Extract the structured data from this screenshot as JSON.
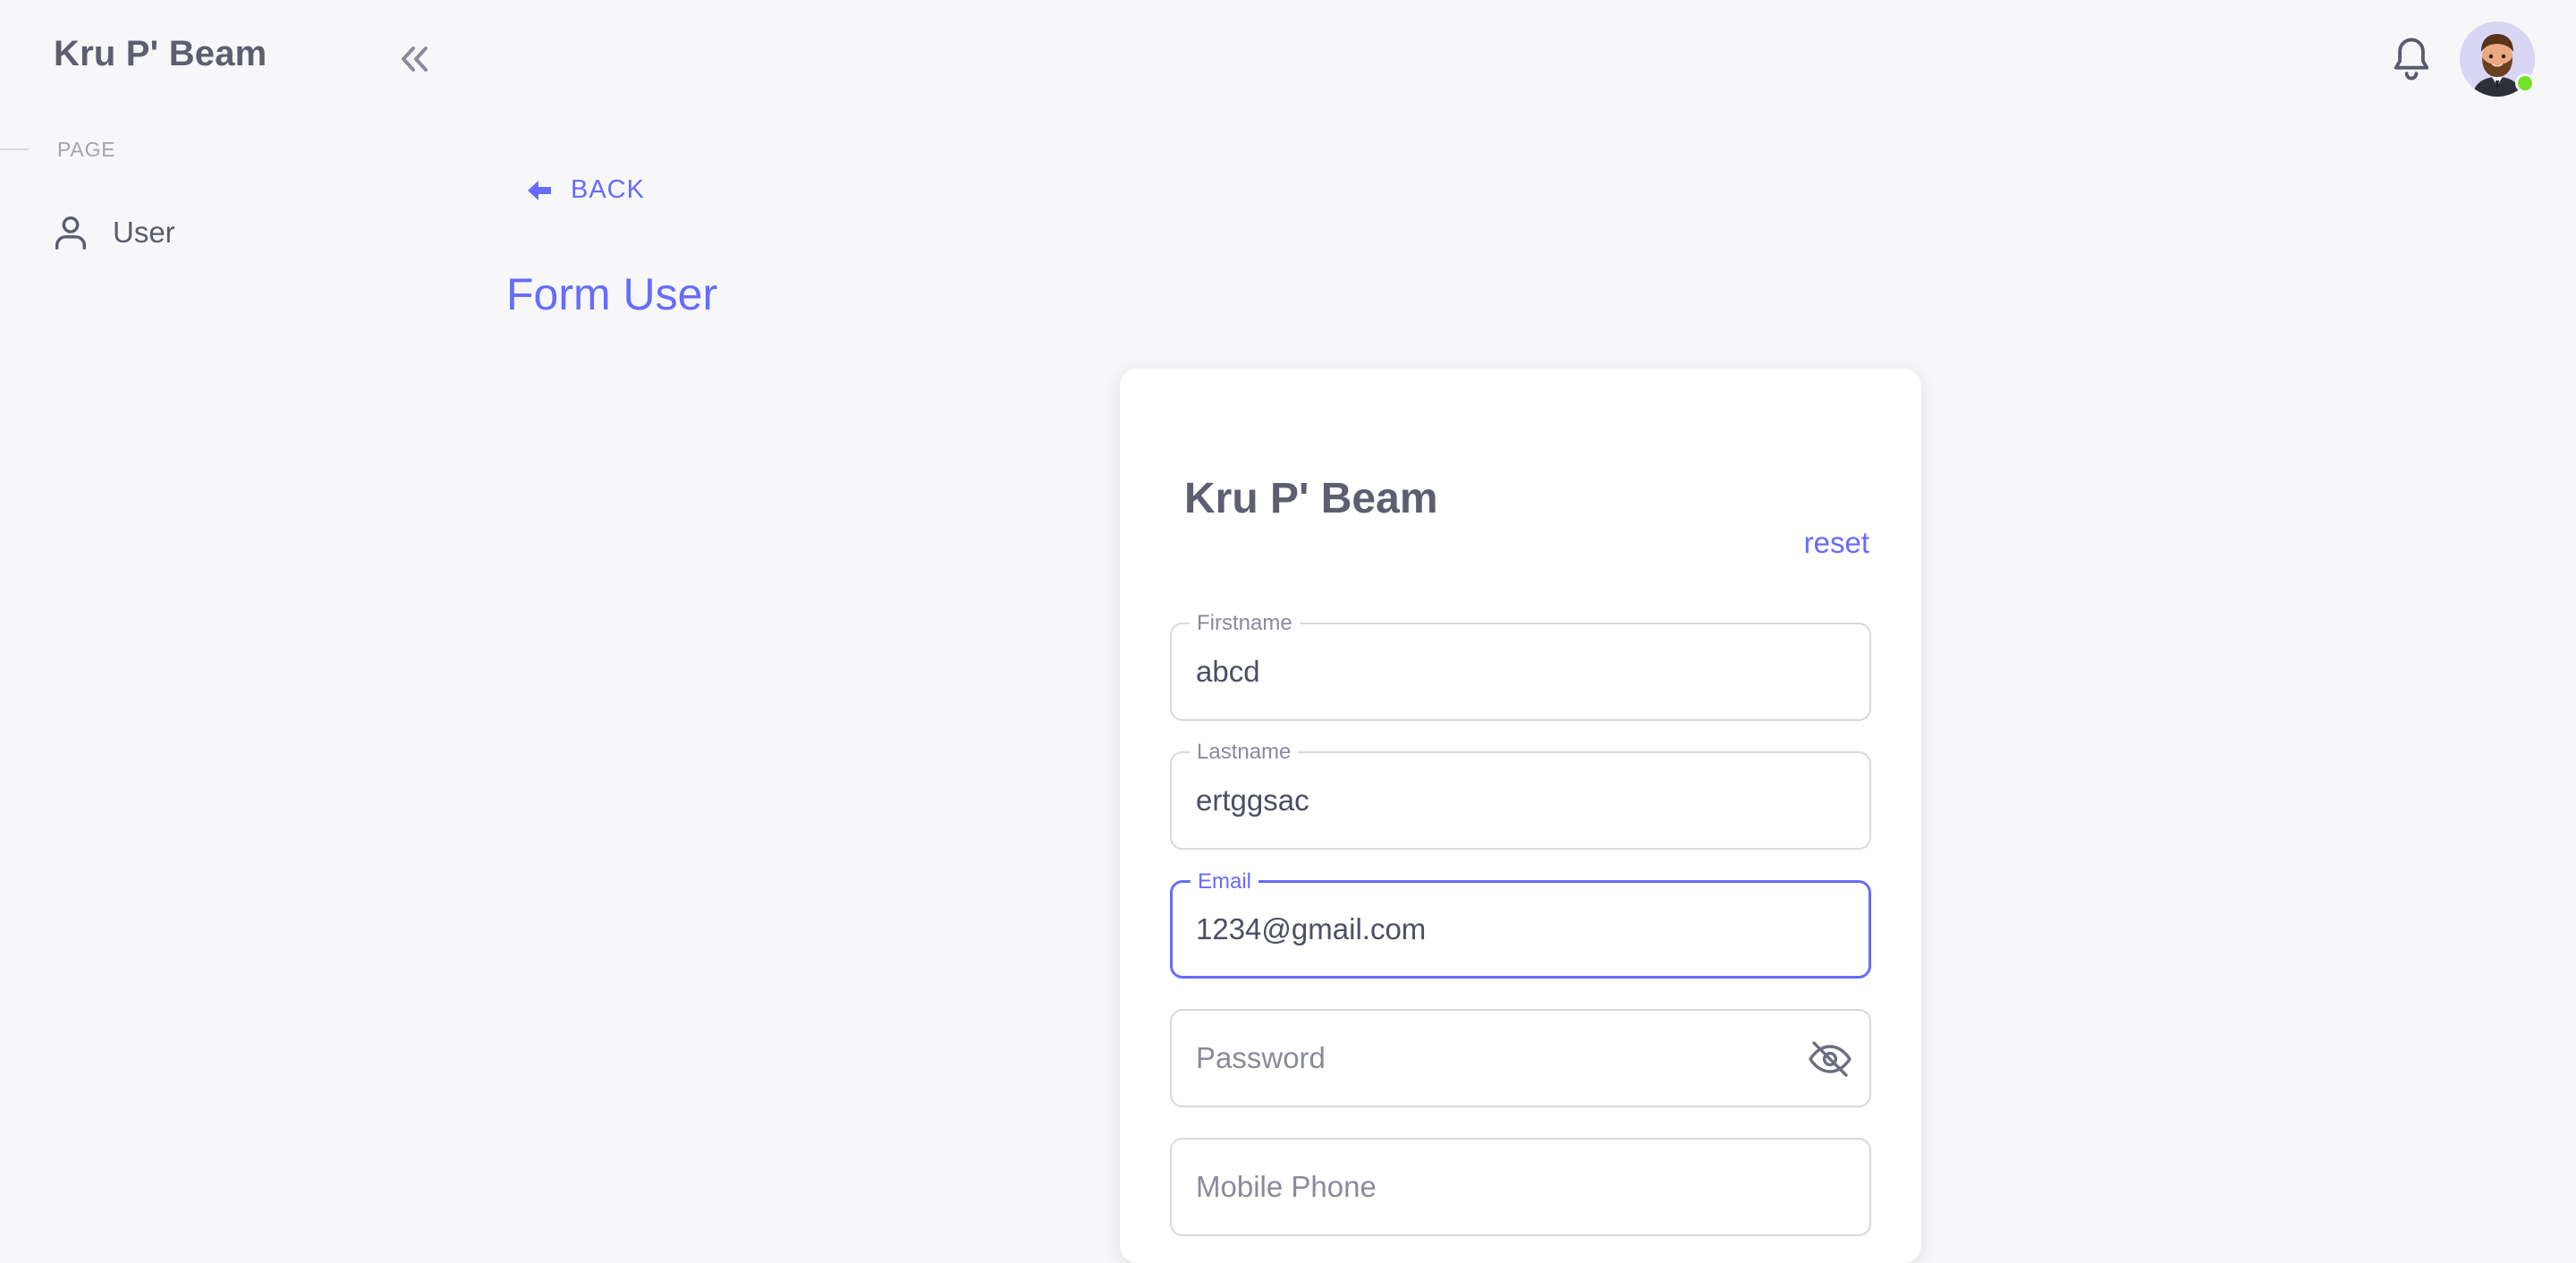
{
  "app": {
    "brand": "Kru P' Beam"
  },
  "sidebar": {
    "section_label": "PAGE",
    "items": [
      {
        "label": "User",
        "icon": "user-icon"
      }
    ]
  },
  "header": {
    "notification_icon": "bell-icon",
    "avatar_status_color": "#72e128"
  },
  "page": {
    "back_label": "BACK",
    "title": "Form User"
  },
  "card": {
    "title": "Kru P' Beam",
    "reset_label": "reset",
    "fields": {
      "firstname": {
        "label": "Firstname",
        "value": "abcd"
      },
      "lastname": {
        "label": "Lastname",
        "value": "ertggsac"
      },
      "email": {
        "label": "Email",
        "value": "1234@gmail.com"
      },
      "password": {
        "placeholder": "Password",
        "icon": "eye-off-icon"
      },
      "mobile": {
        "placeholder": "Mobile Phone"
      }
    }
  },
  "colors": {
    "primary": "#666cff",
    "background": "#f7f7f9",
    "text": "#4c4e64"
  }
}
